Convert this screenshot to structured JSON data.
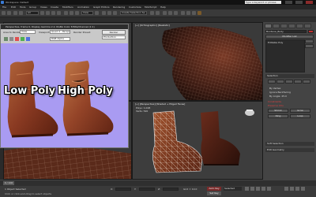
{
  "window": {
    "title": "Workspace: Default",
    "search_placeholder": "Type a keyword or phrase"
  },
  "menubar": [
    "File",
    "Edit",
    "Tools",
    "Group",
    "Views",
    "Create",
    "Modifiers",
    "Animation",
    "Graph Editors",
    "Rendering",
    "Customize",
    "MAXScript",
    "Help"
  ],
  "toolbar": {
    "selection_filter": "All",
    "view_dropdown": "View",
    "named_selection": "Create Selection Se"
  },
  "viewports": {
    "top_right_label": "[+] [Orthographic] [Realistic]",
    "bottom_right_label": "[+] [Perspective] [Shaded + Edged Faces]",
    "stats": [
      "Polys: 1,028",
      "Verts: 520"
    ]
  },
  "render_window": {
    "title": "Perspective, frame 0, Display Gamma 2.2, RGBA Color 8 Bits/Channel (1:1)",
    "area_label": "Area to Render:",
    "area_value": "View",
    "viewport_label": "Viewport:",
    "viewport_value": "Quad 4 - Perspec",
    "render_preset": "Render Preset:",
    "render_button": "Render",
    "production": "Production",
    "channel_value": "RGB Alpha",
    "labels": {
      "low_poly": "Low Poly",
      "high_poly": "High Poly"
    }
  },
  "command_panel": {
    "object_name": "BootLow_Body",
    "modifier_list": "Modifier List",
    "stack_item": "Editable Poly",
    "rollout_selection": "Selection",
    "rollout_soft": "Soft Selection",
    "rollout_edit": "Edit Geometry",
    "red_labels": [
      "Constraints",
      "Preserve UVs"
    ],
    "options": [
      "By Vertex",
      "Ignore Backfacing",
      "By Angle: 45.0",
      "Shrink",
      "Grow",
      "Ring",
      "Loop"
    ]
  },
  "timeline": {
    "frame": "0 / 100"
  },
  "status": {
    "message": "1 Object Selected",
    "hint": "Click or click-and-drag to select objects",
    "x": "X:",
    "y": "Y:",
    "z": "Z:",
    "grid": "Grid = 10.0",
    "autokey": "Auto Key",
    "setkey": "Set Key",
    "selected": "Selected"
  },
  "colors": {
    "accent": "#3a7bd5",
    "render_bg": "#a99bf2",
    "boot_base": "#8a3a22",
    "viewport_bg": "#3b3b3b"
  }
}
